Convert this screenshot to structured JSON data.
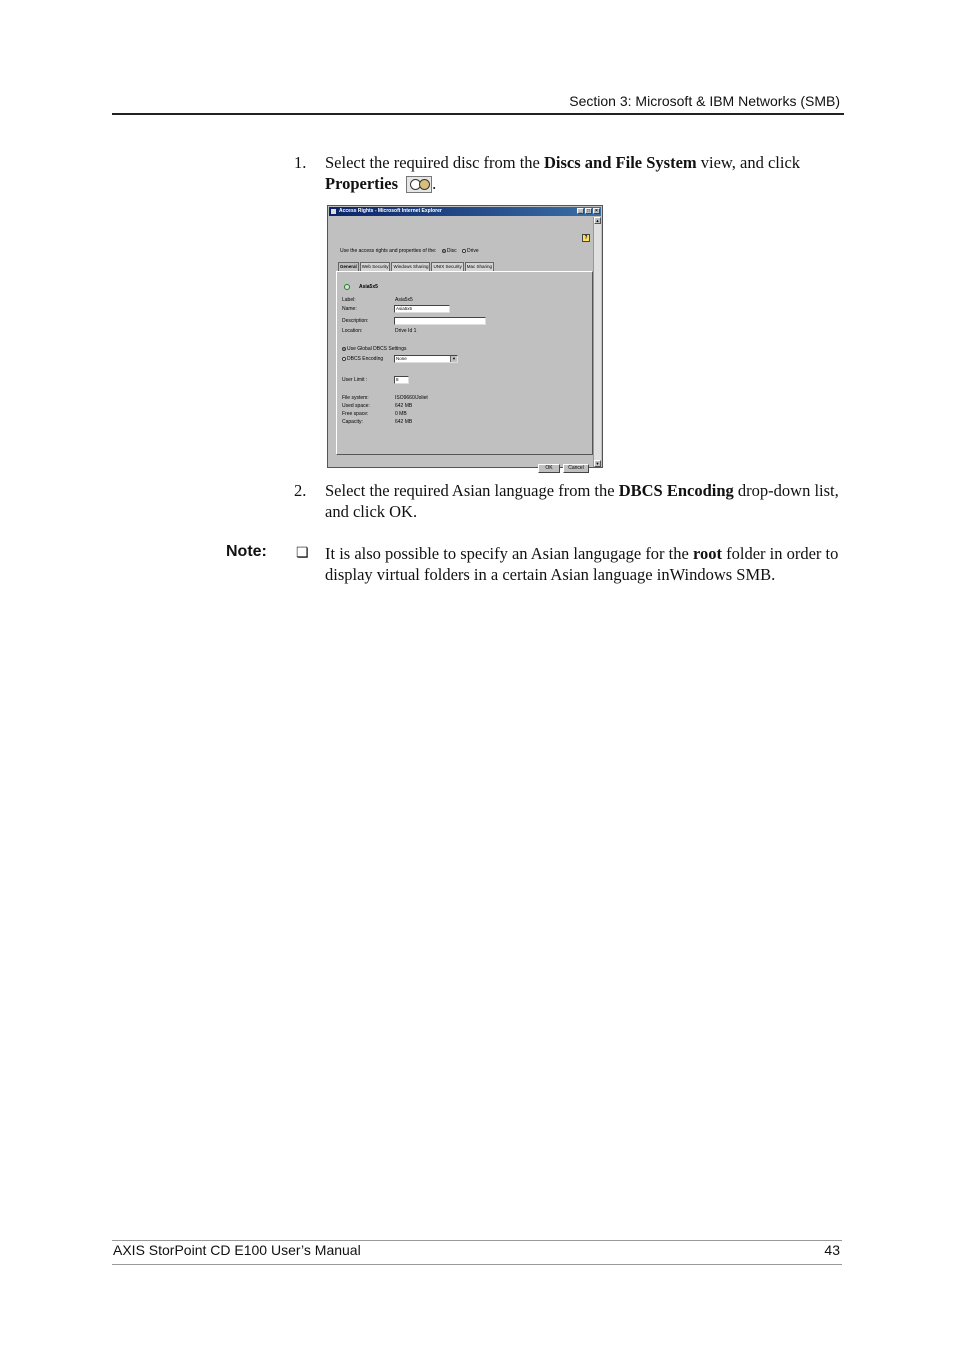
{
  "header": {
    "section": "Section 3: Microsoft & IBM Networks (SMB)"
  },
  "steps": [
    {
      "num": "1.",
      "line1_a": "Select the required disc from the ",
      "line1_b": "Discs and File System",
      "line1_c": " view, and click",
      "line2_a": "Properties",
      "line2_b": "."
    },
    {
      "num": "2.",
      "line1_a": "Select the required Asian language from the ",
      "line1_b": "DBCS Encoding",
      "line1_c": " drop-down list,",
      "line2": "and click OK."
    }
  ],
  "note": {
    "label": "Note:",
    "bullet": "❏",
    "text_a": "It is also possible to specify an Asian langugage for the ",
    "text_b": "root",
    "text_c": " folder in order to display virtual folders in a certain Asian language inWindows SMB."
  },
  "dialog": {
    "title": "Access Rights - Microsoft Internet Explorer",
    "controls": {
      "minimize": "_",
      "maximize": "□",
      "close": "×"
    },
    "help": "?",
    "use_text": "Use the access rights and properties of the:",
    "radio_disc": "Disc",
    "radio_drive": "Drive",
    "tabs": [
      "General",
      "Web Security",
      "Windows Sharing",
      "UNIX Security",
      "Mac Sharing"
    ],
    "disc_name": "Asia5x5",
    "fields": {
      "label_label": "Label:",
      "label_value": "Asia5x5",
      "name_label": "Name:",
      "name_value": "Asia5x5",
      "description_label": "Description:",
      "description_value": "",
      "location_label": "Location:",
      "location_value": "Drive Id 1"
    },
    "use_global": "Use Global DBCS Settings",
    "dbcs_label": "DBCS Encoding",
    "dbcs_value": "None",
    "user_limit_label": "User Limit :",
    "user_limit_value": "8",
    "stats": {
      "fs_label": "File system:",
      "fs_value": "ISO9660/Joliet",
      "used_label": "Used space:",
      "used_value": "642 MB",
      "free_label": "Free space:",
      "free_value": "0 MB",
      "cap_label": "Capacity:",
      "cap_value": "642 MB"
    },
    "ok": "OK",
    "cancel": "Cancel"
  },
  "footer": {
    "manual": "AXIS StorPoint CD E100 User’s Manual",
    "page": "43"
  }
}
